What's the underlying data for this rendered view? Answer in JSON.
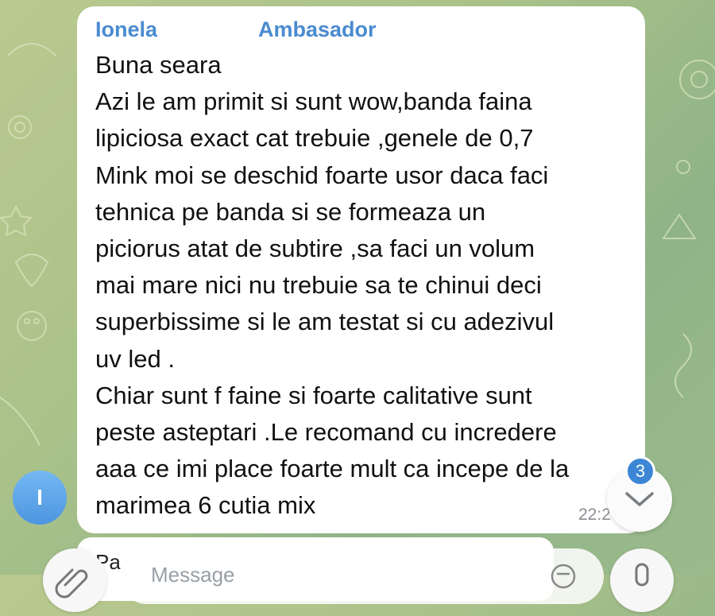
{
  "message": {
    "sender": "Ionela",
    "sender_role": "Ambasador",
    "lines": [
      "Buna seara",
      "Azi le am primit si sunt wow,banda faina",
      "lipiciosa exact cat trebuie ,genele de 0,7",
      "Mink moi  se deschid foarte usor daca faci",
      "tehnica pe banda  si se formeaza un",
      "piciorus atat de subtire ,sa faci un volum",
      "mai mare nici nu trebuie sa te chinui  deci",
      "superbissime si le am testat si cu adezivul",
      "uv led .",
      "Chiar sunt f faine  si foarte calitative sunt",
      "peste asteptari .Le recomand cu incredere",
      "aaa ce imi place foarte mult ca incepe de la",
      "marimea 6 cutia mix"
    ],
    "time": "22:2"
  },
  "avatar": {
    "initial": "I",
    "color": "#5aa2ea"
  },
  "scroll_down": {
    "unread_count": "3",
    "icon": "chevron-down-icon"
  },
  "next_message": {
    "preview": "Pa"
  },
  "composer": {
    "placeholder": "Message"
  },
  "colors": {
    "accent": "#4a8bd0",
    "badge": "#3d86d6"
  }
}
